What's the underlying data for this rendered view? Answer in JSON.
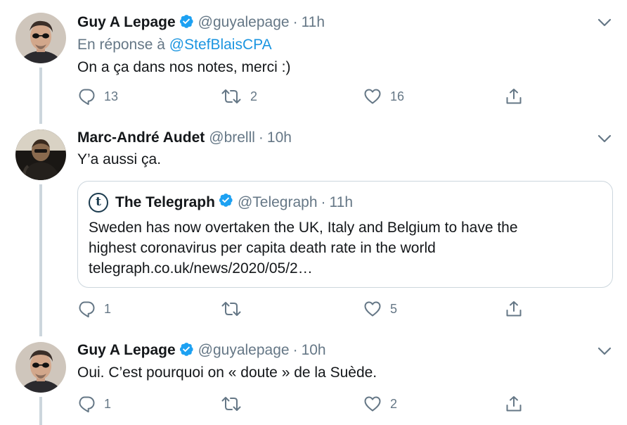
{
  "tweets": [
    {
      "name": "Guy A Lepage",
      "handle": "@guyalepage",
      "dot": "·",
      "time": "11h",
      "reply_prefix": "En réponse à",
      "reply_to": "@StefBlaisCPA",
      "text": "On a ça dans nos notes, merci :)",
      "replies": "13",
      "retweets": "2",
      "likes": "16"
    },
    {
      "name": "Marc-André Audet",
      "handle": "@brelll",
      "dot": "·",
      "time": "10h",
      "text": "Y’a aussi ça.",
      "quote": {
        "name": "The Telegraph",
        "logo_letter": "t",
        "handle": "@Telegraph",
        "dot": "·",
        "time": "11h",
        "line1": "Sweden has now overtaken the UK, Italy and Belgium to have the",
        "line2": "highest coronavirus per capita death rate in the world",
        "line3": "telegraph.co.uk/news/2020/05/2…"
      },
      "replies": "1",
      "retweets": "",
      "likes": "5"
    },
    {
      "name": "Guy A Lepage",
      "handle": "@guyalepage",
      "dot": "·",
      "time": "10h",
      "text": "Oui. C’est pourquoi on « doute » de la Suède.",
      "replies": "1",
      "retweets": "",
      "likes": "2"
    }
  ],
  "icons": {
    "reply": "reply-icon",
    "retweet": "retweet-icon",
    "like": "heart-icon",
    "share": "share-icon",
    "verified": "verified-badge-icon",
    "caret": "chevron-down-icon"
  },
  "colors": {
    "text": "#14171a",
    "secondary": "#657786",
    "link": "#1b95e0",
    "verified": "#1da1f2",
    "border": "#ccd6dd"
  }
}
